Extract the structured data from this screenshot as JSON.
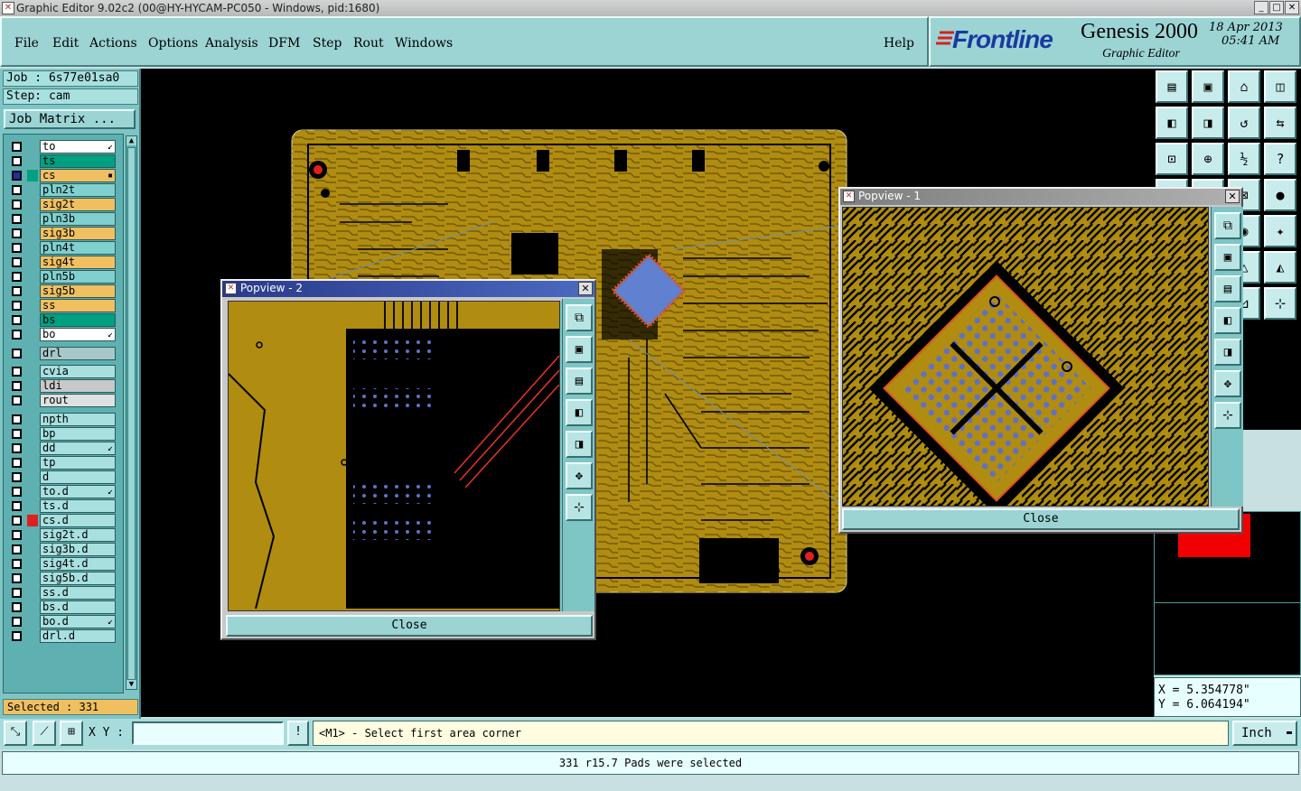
{
  "window": {
    "title": "Graphic Editor 9.02c2 (00@HY-HYCAM-PC050 - Windows, pid:1680)",
    "min": "_",
    "max": "□",
    "close": "✕"
  },
  "menu": [
    "File",
    "Edit",
    "Actions",
    "Options",
    "Analysis",
    "DFM",
    "Step",
    "Rout",
    "Windows"
  ],
  "help_label": "Help",
  "brand": {
    "logo": "Frontline",
    "product": "Genesis 2000",
    "subtitle": "Graphic Editor",
    "date": "18 Apr 2013",
    "time": "05:41 AM"
  },
  "job": {
    "job_label": "Job : 6s77e01sa0",
    "step_label": "Step: cam",
    "matrix_button": "Job Matrix ..."
  },
  "layers": [
    {
      "name": "to",
      "color": "#ffffff",
      "mark": "↙"
    },
    {
      "name": "ts",
      "color": "#00a080",
      "mark": ""
    },
    {
      "name": "cs",
      "color": "#f0c060",
      "mark": "▪",
      "work": true
    },
    {
      "name": "pln2t",
      "color": "#80d0d0",
      "mark": ""
    },
    {
      "name": "sig2t",
      "color": "#f0c060",
      "mark": ""
    },
    {
      "name": "pln3b",
      "color": "#80d0d0",
      "mark": ""
    },
    {
      "name": "sig3b",
      "color": "#f0c060",
      "mark": ""
    },
    {
      "name": "pln4t",
      "color": "#80d0d0",
      "mark": ""
    },
    {
      "name": "sig4t",
      "color": "#f0c060",
      "mark": ""
    },
    {
      "name": "pln5b",
      "color": "#80d0d0",
      "mark": ""
    },
    {
      "name": "sig5b",
      "color": "#f0c060",
      "mark": ""
    },
    {
      "name": "ss",
      "color": "#f0c060",
      "mark": ""
    },
    {
      "name": "bs",
      "color": "#00a080",
      "mark": ""
    },
    {
      "name": "bo",
      "color": "#ffffff",
      "mark": "↙"
    },
    {
      "name": "drl",
      "color": "#a8c8c8",
      "mark": ""
    },
    {
      "name": "cvia",
      "color": "#a8e0e0",
      "mark": ""
    },
    {
      "name": "ldi",
      "color": "#c8c8c8",
      "mark": ""
    },
    {
      "name": "rout",
      "color": "#e0e0e0",
      "mark": ""
    },
    {
      "name": "npth",
      "color": "#a8e0e0",
      "mark": ""
    },
    {
      "name": "bp",
      "color": "#a8e0e0",
      "mark": ""
    },
    {
      "name": "dd",
      "color": "#a8e0e0",
      "mark": "↙"
    },
    {
      "name": "tp",
      "color": "#a8e0e0",
      "mark": ""
    },
    {
      "name": "d",
      "color": "#a8e0e0",
      "mark": ""
    },
    {
      "name": "to.d",
      "color": "#a8e0e0",
      "mark": "↙"
    },
    {
      "name": "ts.d",
      "color": "#a8e0e0",
      "mark": ""
    },
    {
      "name": "cs.d",
      "color": "#a8e0e0",
      "mark": "",
      "flag": "#e02020"
    },
    {
      "name": "sig2t.d",
      "color": "#a8e0e0",
      "mark": ""
    },
    {
      "name": "sig3b.d",
      "color": "#a8e0e0",
      "mark": ""
    },
    {
      "name": "sig4t.d",
      "color": "#a8e0e0",
      "mark": ""
    },
    {
      "name": "sig5b.d",
      "color": "#a8e0e0",
      "mark": ""
    },
    {
      "name": "ss.d",
      "color": "#a8e0e0",
      "mark": ""
    },
    {
      "name": "bs.d",
      "color": "#a8e0e0",
      "mark": ""
    },
    {
      "name": "bo.d",
      "color": "#a8e0e0",
      "mark": "↙"
    },
    {
      "name": "drl.d",
      "color": "#a8e0e0",
      "mark": ""
    }
  ],
  "selected_label": "Selected : 331",
  "popview1": {
    "title": "Popview - 1",
    "close_label": "Close"
  },
  "popview2": {
    "title": "Popview - 2",
    "close_label": "Close"
  },
  "coords": {
    "x": "X = 5.354778\"",
    "y": "Y = 6.064194\""
  },
  "xy_label": "X Y :",
  "xy_value": "",
  "prompt_icon": "!",
  "prompt": "<M1> - Select first area corner",
  "units": "Inch",
  "status": "331 r15.7 Pads were selected",
  "colors": {
    "board": "#b08c10",
    "trace": "#000000",
    "accent": "#9cd4d4",
    "drill": "#e02020"
  }
}
